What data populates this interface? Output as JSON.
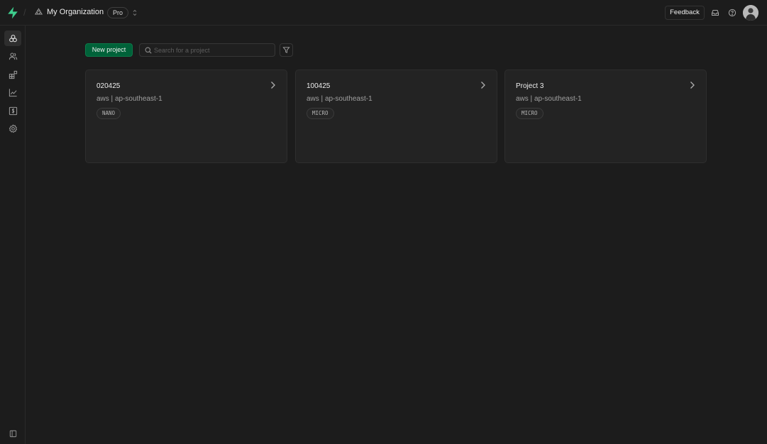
{
  "header": {
    "org_name": "My Organization",
    "plan_badge": "Pro",
    "feedback_label": "Feedback",
    "brand_color": "#3ecf8e"
  },
  "toolbar": {
    "new_project_label": "New project",
    "search_placeholder": "Search for a project",
    "search_value": ""
  },
  "sidebar": {
    "items": [
      {
        "name": "projects",
        "icon": "projects-icon",
        "active": true
      },
      {
        "name": "team",
        "icon": "team-icon",
        "active": false
      },
      {
        "name": "integrations",
        "icon": "integrations-icon",
        "active": false
      },
      {
        "name": "usage",
        "icon": "usage-icon",
        "active": false
      },
      {
        "name": "billing",
        "icon": "billing-icon",
        "active": false
      },
      {
        "name": "settings",
        "icon": "settings-icon",
        "active": false
      }
    ]
  },
  "projects": [
    {
      "name": "020425",
      "region": "aws | ap-southeast-1",
      "size": "NANO"
    },
    {
      "name": "100425",
      "region": "aws | ap-southeast-1",
      "size": "MICRO"
    },
    {
      "name": "Project 3",
      "region": "aws | ap-southeast-1",
      "size": "MICRO"
    }
  ]
}
